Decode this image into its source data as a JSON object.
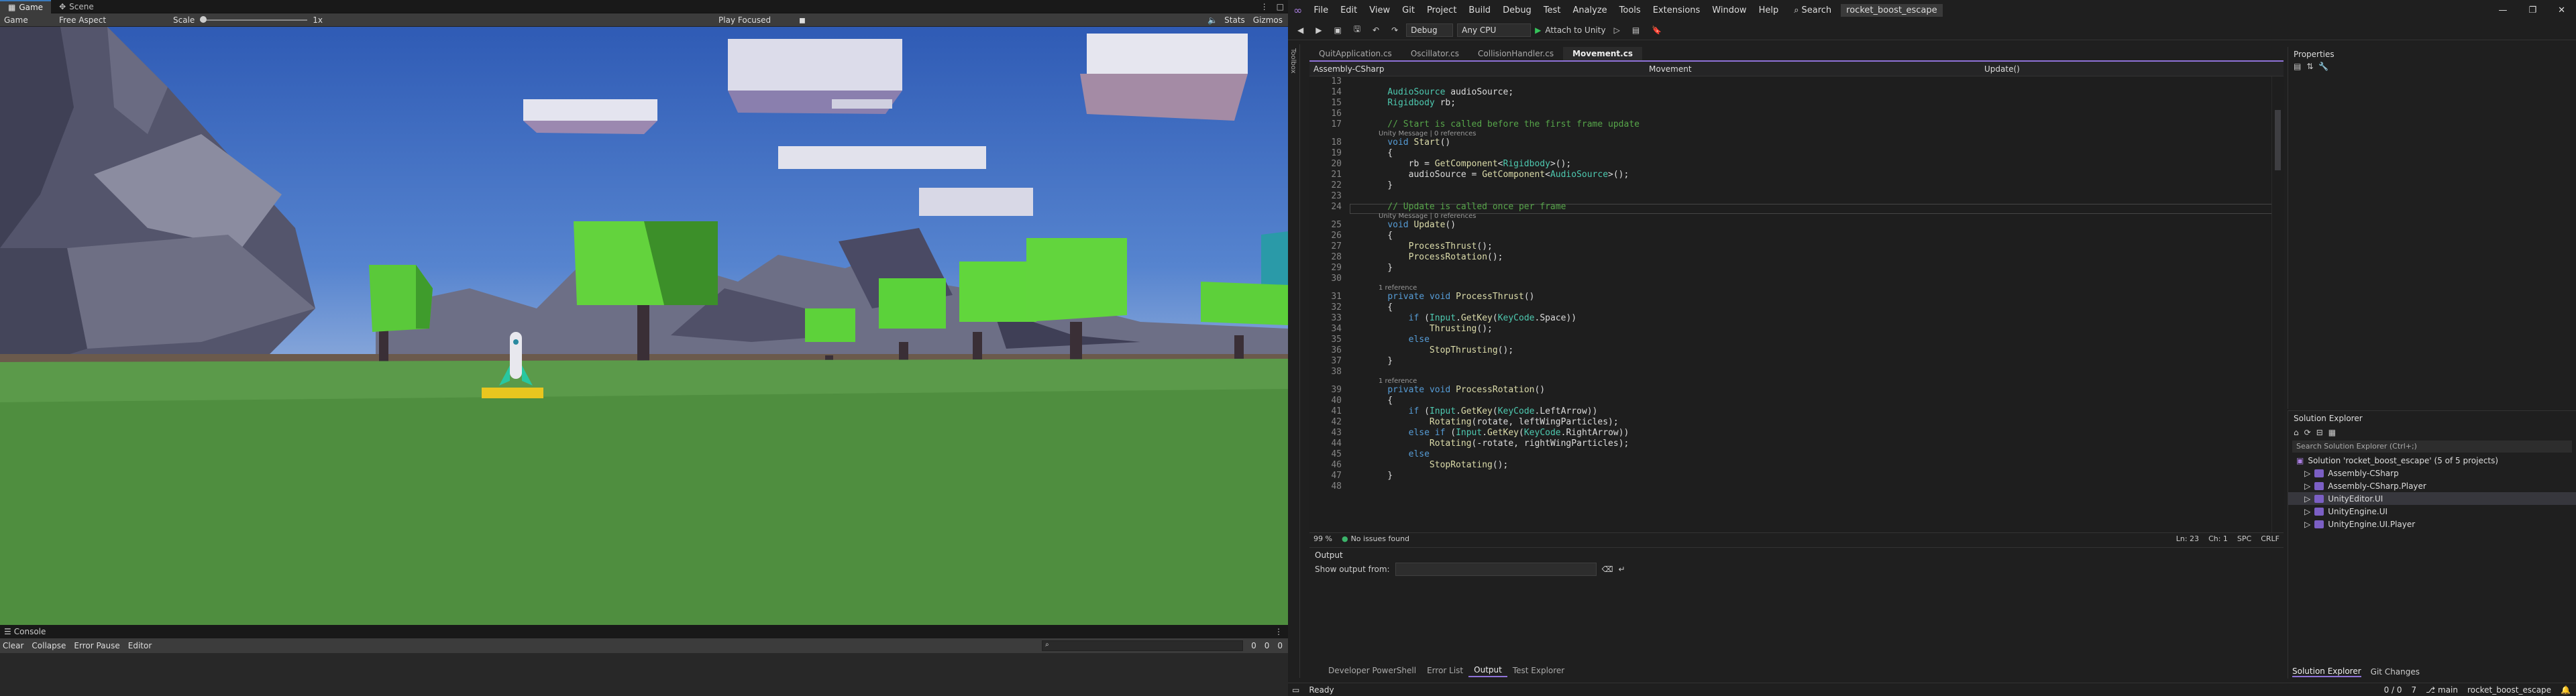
{
  "unity": {
    "tabs": [
      {
        "label": "Game",
        "icon": "game-icon"
      },
      {
        "label": "Scene",
        "icon": "scene-icon"
      }
    ],
    "display": "Game",
    "aspect": "Free Aspect",
    "scale_label": "Scale",
    "scale_value": "1x",
    "play_mode": "Play Focused",
    "stats": "Stats",
    "gizmos": "Gizmos",
    "console": {
      "tab": "Console",
      "clear": "Clear",
      "collapse": "Collapse",
      "error_pause": "Error Pause",
      "editor": "Editor",
      "counts": [
        "0",
        "0",
        "0"
      ]
    }
  },
  "vs": {
    "menu": [
      "File",
      "Edit",
      "View",
      "Git",
      "Project",
      "Build",
      "Debug",
      "Test",
      "Analyze",
      "Tools",
      "Extensions",
      "Window",
      "Help"
    ],
    "search": "Search",
    "solution_name": "rocket_boost_escape",
    "config": "Debug",
    "platform": "Any CPU",
    "run_label": "Attach to Unity",
    "doc_tabs": [
      "QuitApplication.cs",
      "Oscillator.cs",
      "CollisionHandler.cs",
      "Movement.cs"
    ],
    "nav": {
      "project": "Assembly-CSharp",
      "type": "Movement",
      "member": "Update()"
    },
    "editor_lines": [
      {
        "n": "13",
        "t": ""
      },
      {
        "n": "14",
        "t": "    AudioSource audioSource;"
      },
      {
        "n": "15",
        "t": "    Rigidbody rb;"
      },
      {
        "n": "16",
        "t": ""
      },
      {
        "n": "17",
        "t": "    // Start is called before the first frame update"
      },
      {
        "n": "",
        "t": "Unity Message | 0 references",
        "lens": true
      },
      {
        "n": "18",
        "t": "    void Start()"
      },
      {
        "n": "19",
        "t": "    {"
      },
      {
        "n": "20",
        "t": "        rb = GetComponent<Rigidbody>();"
      },
      {
        "n": "21",
        "t": "        audioSource = GetComponent<AudioSource>();"
      },
      {
        "n": "22",
        "t": "    }"
      },
      {
        "n": "23",
        "t": ""
      },
      {
        "n": "24",
        "t": "    // Update is called once per frame"
      },
      {
        "n": "",
        "t": "Unity Message | 0 references",
        "lens": true
      },
      {
        "n": "25",
        "t": "    void Update()"
      },
      {
        "n": "26",
        "t": "    {"
      },
      {
        "n": "27",
        "t": "        ProcessThrust();"
      },
      {
        "n": "28",
        "t": "        ProcessRotation();"
      },
      {
        "n": "29",
        "t": "    }"
      },
      {
        "n": "30",
        "t": ""
      },
      {
        "n": "",
        "t": "1 reference",
        "lens": true
      },
      {
        "n": "31",
        "t": "    private void ProcessThrust()"
      },
      {
        "n": "32",
        "t": "    {"
      },
      {
        "n": "33",
        "t": "        if (Input.GetKey(KeyCode.Space))"
      },
      {
        "n": "34",
        "t": "            Thrusting();"
      },
      {
        "n": "35",
        "t": "        else"
      },
      {
        "n": "36",
        "t": "            StopThrusting();"
      },
      {
        "n": "37",
        "t": "    }"
      },
      {
        "n": "38",
        "t": ""
      },
      {
        "n": "",
        "t": "1 reference",
        "lens": true
      },
      {
        "n": "39",
        "t": "    private void ProcessRotation()"
      },
      {
        "n": "40",
        "t": "    {"
      },
      {
        "n": "41",
        "t": "        if (Input.GetKey(KeyCode.LeftArrow))"
      },
      {
        "n": "42",
        "t": "            Rotating(rotate, leftWingParticles);"
      },
      {
        "n": "43",
        "t": "        else if (Input.GetKey(KeyCode.RightArrow))"
      },
      {
        "n": "44",
        "t": "            Rotating(-rotate, rightWingParticles);"
      },
      {
        "n": "45",
        "t": "        else"
      },
      {
        "n": "46",
        "t": "            StopRotating();"
      },
      {
        "n": "47",
        "t": "    }"
      },
      {
        "n": "48",
        "t": ""
      }
    ],
    "editor_status": {
      "zoom": "99 %",
      "issues": "No issues found",
      "ln": "Ln: 23",
      "ch": "Ch: 1",
      "spc": "SPC",
      "crlf": "CRLF"
    },
    "output": {
      "title": "Output",
      "show_from": "Show output from:"
    },
    "output_tabs": [
      "Developer PowerShell",
      "Error List",
      "Output",
      "Test Explorer"
    ],
    "properties_title": "Properties",
    "solution_explorer": {
      "title": "Solution Explorer",
      "search": "Search Solution Explorer (Ctrl+;)",
      "root": "Solution 'rocket_boost_escape' (5 of 5 projects)",
      "projects": [
        "Assembly-CSharp",
        "Assembly-CSharp.Player",
        "UnityEditor.UI",
        "UnityEngine.UI",
        "UnityEngine.UI.Player"
      ],
      "tabs": [
        "Solution Explorer",
        "Git Changes"
      ]
    },
    "status": {
      "ready": "Ready",
      "lines": "0 / 0",
      "pencil": "7",
      "branch": "main",
      "repo": "rocket_boost_escape"
    }
  }
}
